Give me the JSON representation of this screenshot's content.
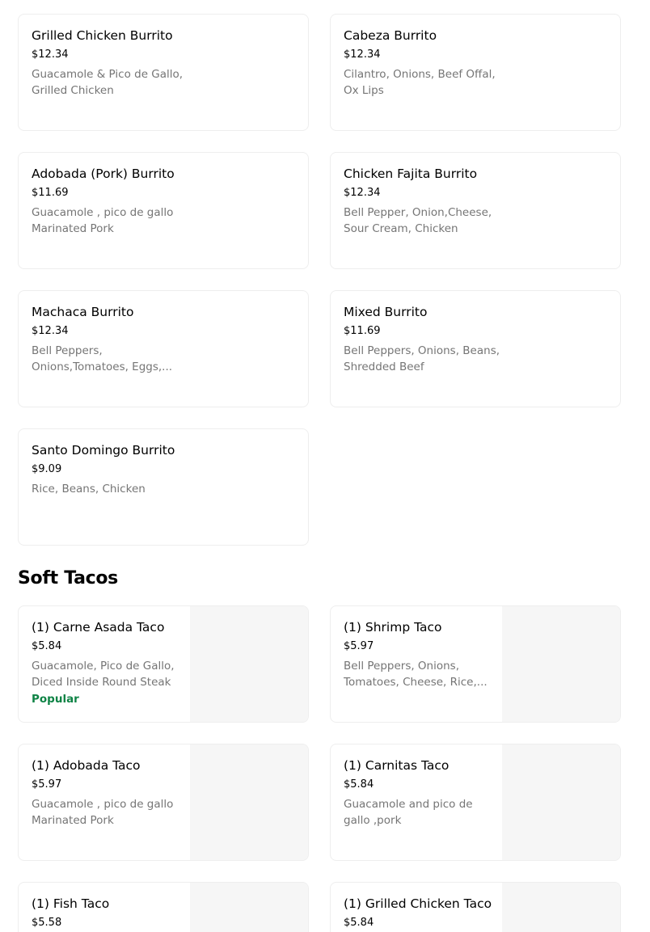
{
  "burritos": [
    {
      "name": "Grilled Chicken Burrito",
      "price": "$12.34",
      "desc": "Guacamole & Pico de Gallo, Grilled Chicken"
    },
    {
      "name": "Cabeza Burrito",
      "price": "$12.34",
      "desc": "Cilantro, Onions, Beef Offal, Ox Lips"
    },
    {
      "name": "Adobada (Pork) Burrito",
      "price": "$11.69",
      "desc": "Guacamole , pico de gallo Marinated Pork"
    },
    {
      "name": "Chicken Fajita Burrito",
      "price": "$12.34",
      "desc": "Bell Pepper, Onion,Cheese, Sour Cream, Chicken"
    },
    {
      "name": "Machaca Burrito",
      "price": "$12.34",
      "desc": "Bell Peppers, Onions,Tomatoes, Eggs,..."
    },
    {
      "name": "Mixed Burrito",
      "price": "$11.69",
      "desc": "Bell Peppers, Onions, Beans, Shredded Beef"
    },
    {
      "name": "Santo Domingo Burrito",
      "price": "$9.09",
      "desc": "Rice, Beans, Chicken"
    }
  ],
  "soft_tacos": {
    "title": "Soft Tacos",
    "items": [
      {
        "name": "(1) Carne Asada Taco",
        "price": "$5.84",
        "desc": "Guacamole, Pico de Gallo, Diced Inside Round Steak",
        "badge": "Popular"
      },
      {
        "name": "(1) Shrimp Taco",
        "price": "$5.97",
        "desc": "Bell Peppers, Onions, Tomatoes, Cheese, Rice,..."
      },
      {
        "name": "(1) Adobada Taco",
        "price": "$5.97",
        "desc": "Guacamole , pico de gallo Marinated Pork"
      },
      {
        "name": "(1) Carnitas Taco",
        "price": "$5.84",
        "desc": "Guacamole and pico de gallo ,pork"
      },
      {
        "name": "(1) Fish Taco",
        "price": "$5.58"
      },
      {
        "name": "(1) Grilled Chicken Taco",
        "price": "$5.84"
      }
    ]
  }
}
